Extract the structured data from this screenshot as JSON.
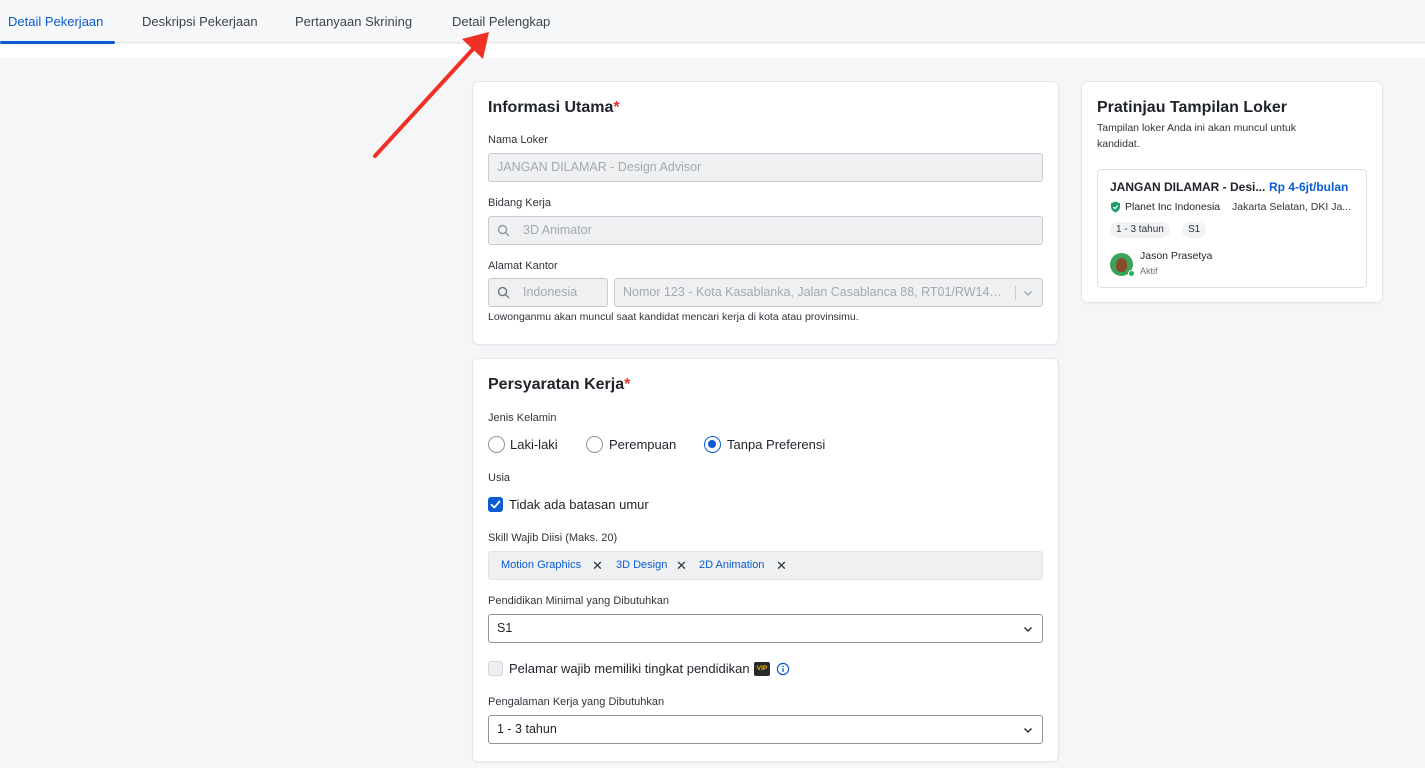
{
  "tabs": [
    {
      "label": "Detail Pekerjaan",
      "active": true
    },
    {
      "label": "Deskripsi Pekerjaan",
      "active": false
    },
    {
      "label": "Pertanyaan Skrining",
      "active": false
    },
    {
      "label": "Detail Pelengkap",
      "active": false
    }
  ],
  "main_info": {
    "title": "Informasi Utama",
    "required_mark": "*",
    "job_name_label": "Nama Loker",
    "job_name_value": "JANGAN DILAMAR - Design Advisor",
    "field_label": "Bidang Kerja",
    "field_value": "3D Animator",
    "address_label": "Alamat Kantor",
    "country_value": "Indonesia",
    "address_value": "Nomor 123 - Kota Kasablanka, Jalan Casablanca 88, RT01/RW14, M...",
    "address_helper": "Lowonganmu akan muncul saat kandidat mencari kerja di kota atau provinsimu."
  },
  "requirements": {
    "title": "Persyaratan Kerja",
    "required_mark": "*",
    "gender_label": "Jenis Kelamin",
    "gender_options": [
      "Laki-laki",
      "Perempuan",
      "Tanpa Preferensi"
    ],
    "gender_selected": "Tanpa Preferensi",
    "age_label": "Usia",
    "age_checkbox_label": "Tidak ada batasan umur",
    "age_checked": true,
    "skills_label": "Skill Wajib Diisi (Maks. 20)",
    "skills": [
      "Motion Graphics",
      "3D Design",
      "2D Animation"
    ],
    "remove_symbol": "✕",
    "education_label": "Pendidikan Minimal yang Dibutuhkan",
    "education_value": "S1",
    "education_required_label": "Pelamar wajib memiliki tingkat pendidikan",
    "education_required_checked": false,
    "vip_badge": "VIP",
    "experience_label": "Pengalaman Kerja yang Dibutuhkan",
    "experience_value": "1 - 3 tahun"
  },
  "preview": {
    "title": "Pratinjau Tampilan Loker",
    "description_line1": "Tampilan loker Anda ini akan muncul untuk",
    "description_line2": "kandidat.",
    "job_title": "JANGAN DILAMAR - Desi...",
    "salary": "Rp 4-6jt/bulan",
    "company": "Planet Inc Indonesia",
    "location": "Jakarta Selatan, DKI Ja...",
    "chips": [
      "1 - 3 tahun",
      "S1"
    ],
    "recruiter_name": "Jason Prasetya",
    "recruiter_status": "Aktif"
  },
  "colors": {
    "accent": "#0b5bd3",
    "required": "#e0322d",
    "annotation_arrow": "#ee3124",
    "verified": "#1f9d6a",
    "online": "#21b35b"
  },
  "icons": [
    "search-icon",
    "chevron-down-icon",
    "close-icon",
    "info-icon",
    "verified-shield-icon",
    "check-icon"
  ]
}
